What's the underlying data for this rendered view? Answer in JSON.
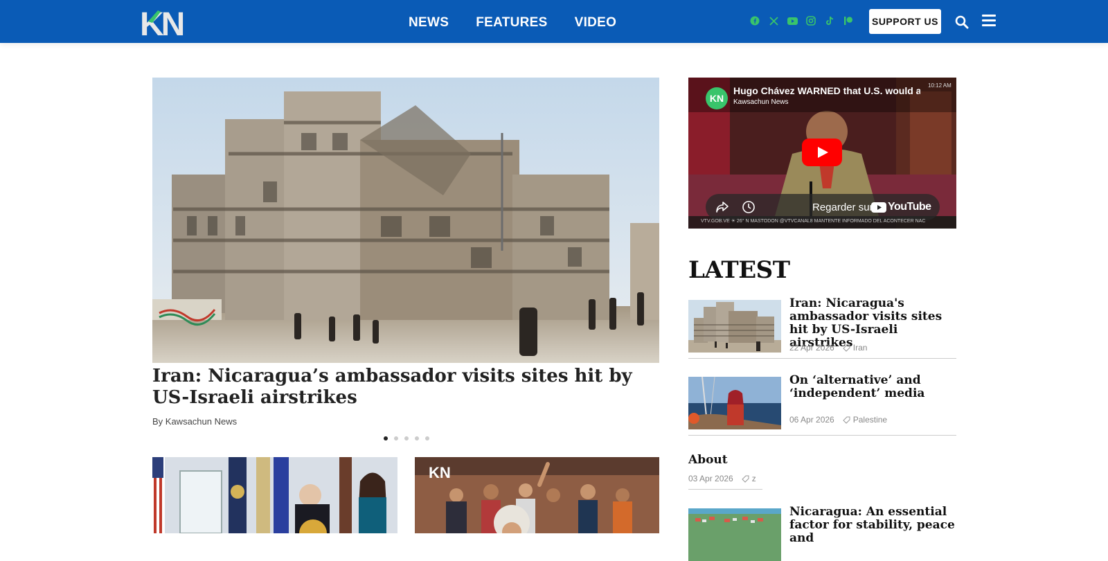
{
  "header": {
    "logo_text": "KN",
    "nav": [
      "NEWS",
      "FEATURES",
      "VIDEO"
    ],
    "support_label": "SUPPORT US",
    "socials": [
      "facebook-icon",
      "x-icon",
      "youtube-icon",
      "instagram-icon",
      "tiktok-icon",
      "patreon-icon"
    ],
    "colors": {
      "bar": "#0a5bb6",
      "social": "#39c46b"
    }
  },
  "hero": {
    "title": "Iran: Nicaragua’s ambassador visits sites hit by US-Israeli airstrikes",
    "byline": "By Kawsachun News",
    "slides": 5,
    "active_slide": 1
  },
  "video": {
    "title": "Hugo Chávez WARNED that U.S. would ap",
    "channel": "Kawsachun News",
    "channel_logo": "KN",
    "watch_label": "Regarder sur",
    "platform": "YouTube",
    "ticker": "VTV.GOB.VE   ☀ 26°   N MASTODON @VTVCANAL8   MANTENTE INFORMADO DEL ACONTECER NAC",
    "clock": "10:12 AM"
  },
  "latest": {
    "heading": "LATEST",
    "items": [
      {
        "title": "Iran: Nicaragua's ambassador visits sites hit by US-Israeli airstrikes",
        "date": "22 Apr 2026",
        "tag": "Iran"
      },
      {
        "title": "On ‘alternative’ and ‘independent’ media",
        "date": "06 Apr 2026",
        "tag": "Palestine"
      },
      {
        "title": "About",
        "date": "03 Apr 2026",
        "tag": "z"
      },
      {
        "title": "Nicaragua: An essential factor for stability, peace and",
        "date": "",
        "tag": ""
      }
    ]
  }
}
